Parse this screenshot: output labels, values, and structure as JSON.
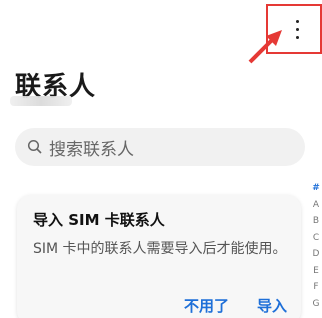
{
  "header": {
    "title": "联系人",
    "more_icon": "more-vertical-icon"
  },
  "search": {
    "placeholder": "搜索联系人",
    "icon": "search-icon"
  },
  "sim_card": {
    "title": "导入 SIM 卡联系人",
    "body": "SIM 卡中的联系人需要导入后才能使用。",
    "skip_label": "不用了",
    "import_label": "导入"
  },
  "index_bar": [
    "#",
    "A",
    "B",
    "C",
    "D",
    "E",
    "F",
    "G"
  ],
  "colors": {
    "accent": "#1e6fd8",
    "highlight": "#e53935"
  }
}
